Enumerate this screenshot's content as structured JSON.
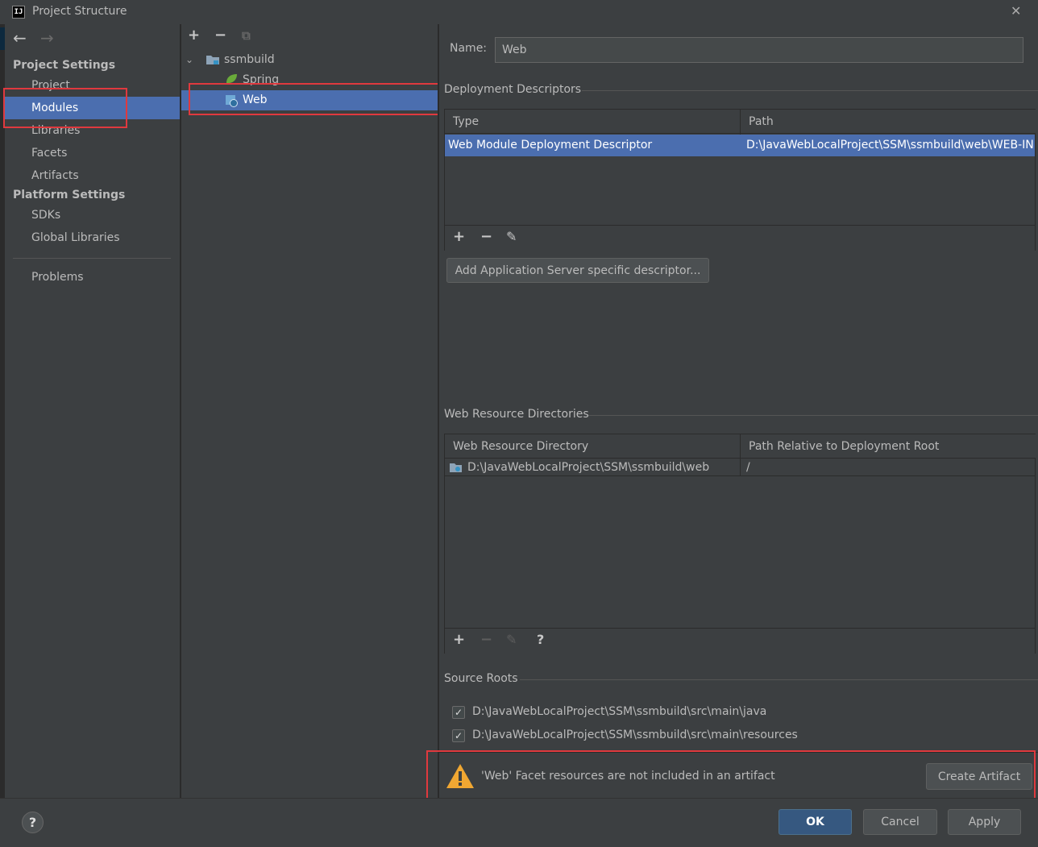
{
  "window": {
    "title": "Project Structure",
    "app_icon": "IJ"
  },
  "left_nav": {
    "sections": [
      {
        "header": "Project Settings",
        "items": [
          "Project",
          "Modules",
          "Libraries",
          "Facets",
          "Artifacts"
        ]
      },
      {
        "header": "Platform Settings",
        "items": [
          "SDKs",
          "Global Libraries"
        ]
      }
    ],
    "problems": "Problems",
    "selected": "Modules"
  },
  "module_tree": {
    "root": "ssmbuild",
    "children": [
      "Spring",
      "Web"
    ],
    "selected": "Web"
  },
  "facet": {
    "name_label": "Name:",
    "name_value": "Web",
    "deployment": {
      "title": "Deployment Descriptors",
      "columns": [
        "Type",
        "Path"
      ],
      "rows": [
        {
          "type": "Web Module Deployment Descriptor",
          "path": "D:\\JavaWebLocalProject\\SSM\\ssmbuild\\web\\WEB-INF\\web.xml"
        }
      ],
      "add_button": "Add Application Server specific descriptor..."
    },
    "resources": {
      "title": "Web Resource Directories",
      "columns": [
        "Web Resource Directory",
        "Path Relative to Deployment Root"
      ],
      "rows": [
        {
          "dir": "D:\\JavaWebLocalProject\\SSM\\ssmbuild\\web",
          "rel": "/"
        }
      ]
    },
    "source_roots": {
      "title": "Source Roots",
      "items": [
        "D:\\JavaWebLocalProject\\SSM\\ssmbuild\\src\\main\\java",
        "D:\\JavaWebLocalProject\\SSM\\ssmbuild\\src\\main\\resources"
      ]
    },
    "warning": {
      "text": "'Web' Facet resources are not included in an artifact",
      "button": "Create Artifact"
    }
  },
  "footer": {
    "ok": "OK",
    "cancel": "Cancel",
    "apply": "Apply",
    "help": "?"
  },
  "colors": {
    "selection": "#4b6eaf",
    "highlight_box": "#e0393e",
    "warning": "#f0a732"
  }
}
